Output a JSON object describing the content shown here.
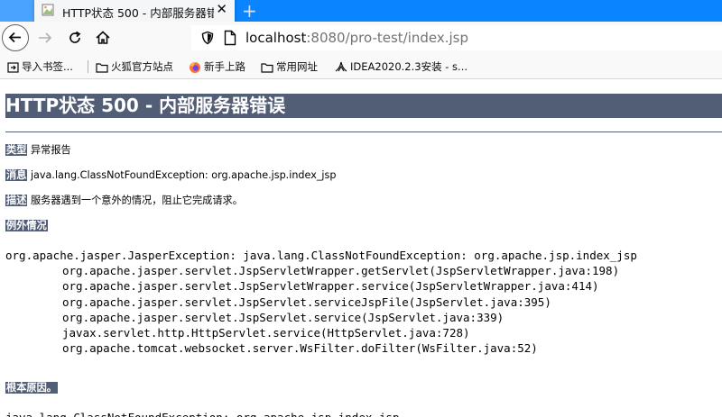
{
  "browser": {
    "tab_title": "HTTP状态 500 - 内部服务器错误",
    "url_host": "localhost",
    "url_path": ":8080/pro-test/index.jsp",
    "bookmarks": [
      {
        "label": "导入书签..."
      },
      {
        "label": "火狐官方站点"
      },
      {
        "label": "新手上路"
      },
      {
        "label": "常用网址"
      },
      {
        "label": "IDEA2020.2.3安装 - s..."
      }
    ]
  },
  "page": {
    "title": "HTTP状态 500 - 内部服务器错误",
    "type_label": "类型",
    "type_value": "异常报告",
    "message_label": "消息",
    "message_value": "java.lang.ClassNotFoundException: org.apache.jsp.index_jsp",
    "description_label": "描述",
    "description_value": "服务器遇到一个意外的情况，阻止它完成请求。",
    "exception_label": "例外情况",
    "stack_first": "org.apache.jasper.JasperException: java.lang.ClassNotFoundException: org.apache.jsp.index_jsp",
    "stack_lines": [
      "org.apache.jasper.servlet.JspServletWrapper.getServlet(JspServletWrapper.java:198)",
      "org.apache.jasper.servlet.JspServletWrapper.service(JspServletWrapper.java:414)",
      "org.apache.jasper.servlet.JspServlet.serviceJspFile(JspServlet.java:395)",
      "org.apache.jasper.servlet.JspServlet.service(JspServlet.java:339)",
      "javax.servlet.http.HttpServlet.service(HttpServlet.java:728)",
      "org.apache.tomcat.websocket.server.WsFilter.doFilter(WsFilter.java:52)"
    ],
    "root_cause_label": "根本原因。",
    "root_cause_first": "java.lang.ClassNotFoundException: org.apache.jsp.index_jsp"
  },
  "colors": {
    "heading_bg": "#525d76",
    "tabstrip": "#0a84ff",
    "toolbar": "#f9f9fa"
  }
}
